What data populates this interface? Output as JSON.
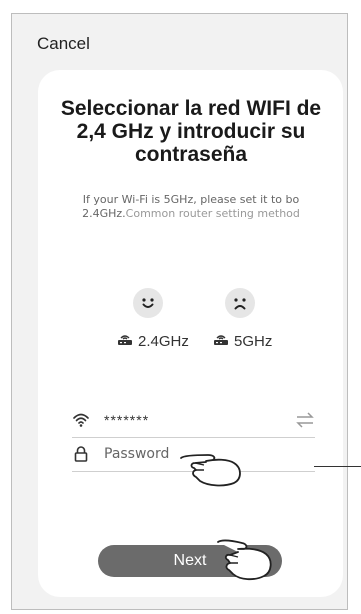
{
  "header": {
    "cancel_label": "Cancel"
  },
  "card": {
    "title": "Seleccionar la red WIFI de 2,4 GHz y introducir su contraseña",
    "subtitle_part1": "If your Wi-Fi is 5GHz, please set it to bo 2.4GHz.",
    "subtitle_part2": "Common router setting method"
  },
  "bands": {
    "good": {
      "icon": "smile-face-icon",
      "label": "2.4GHz"
    },
    "bad": {
      "icon": "frown-face-icon",
      "label": "5GHz"
    }
  },
  "wifi": {
    "icon": "wifi-icon",
    "name": "*******",
    "switch_icon": "switch-network-icon"
  },
  "password": {
    "icon": "lock-icon",
    "placeholder": "Password",
    "value": ""
  },
  "next_label": "Next",
  "colors": {
    "button": "#6b6b6b",
    "card": "#ffffff",
    "background": "#f2f2f2"
  }
}
